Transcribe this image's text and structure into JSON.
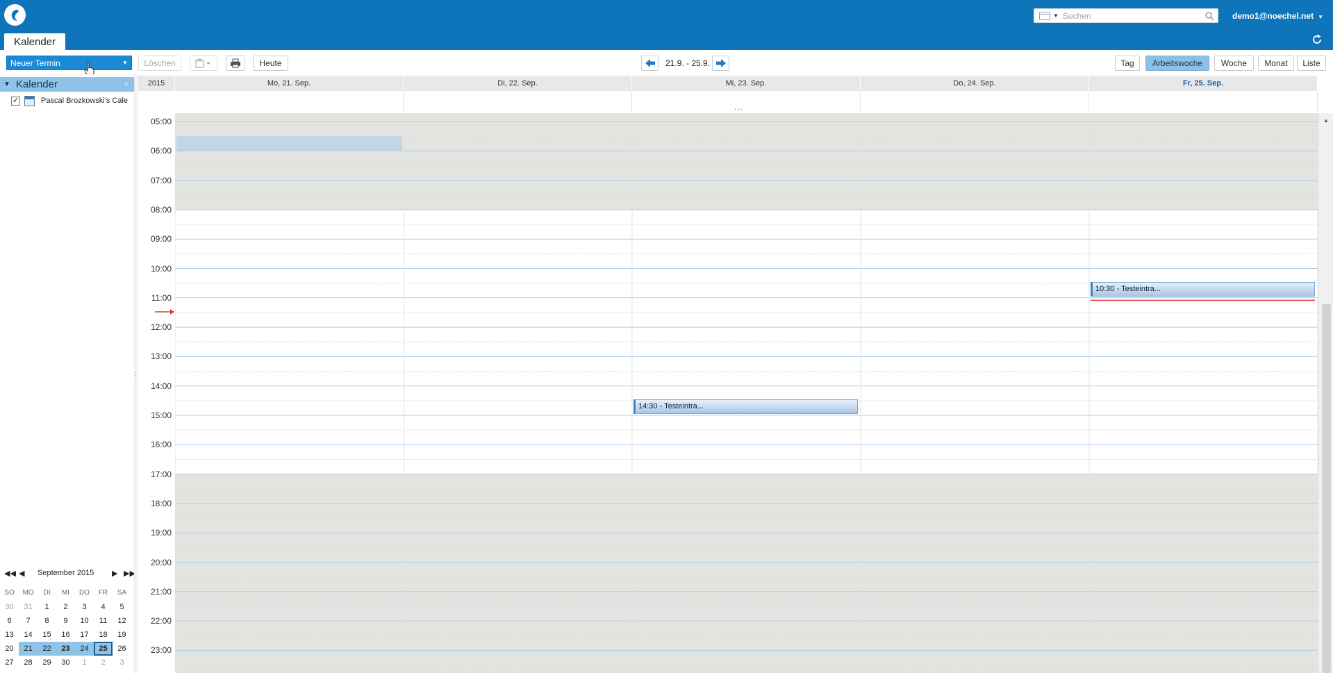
{
  "app": {
    "tab_label": "Kalender",
    "search_placeholder": "Suchen",
    "user": "demo1@noechel.net"
  },
  "toolbar": {
    "new_label": "Neuer Termin",
    "delete_label": "Löschen",
    "today_label": "Heute",
    "range_label": "21.9. - 25.9.",
    "views": [
      "Tag",
      "Arbeitswoche",
      "Woche",
      "Monat",
      "Liste"
    ],
    "active_view": "Arbeitswoche"
  },
  "sidebar": {
    "section_title": "Kalender",
    "calendar_name": "Pascal Brozkowski's Cale"
  },
  "mini_calendar": {
    "month_label": "September 2015",
    "weekdays": [
      "SO",
      "MO",
      "DI",
      "MI",
      "DO",
      "FR",
      "SA"
    ],
    "weeks": [
      [
        "30",
        "31",
        "1",
        "2",
        "3",
        "4",
        "5"
      ],
      [
        "6",
        "7",
        "8",
        "9",
        "10",
        "11",
        "12"
      ],
      [
        "13",
        "14",
        "15",
        "16",
        "17",
        "18",
        "19"
      ],
      [
        "20",
        "21",
        "22",
        "23",
        "24",
        "25",
        "26"
      ],
      [
        "27",
        "28",
        "29",
        "30",
        "1",
        "2",
        "3"
      ]
    ]
  },
  "calendar": {
    "year_label": "2015",
    "days": [
      "Mo, 21. Sep.",
      "Di, 22. Sep.",
      "Mi, 23. Sep.",
      "Do, 24. Sep.",
      "Fr, 25. Sep."
    ],
    "current_day": "Fr, 25. Sep.",
    "more_indicator": "...",
    "hours": [
      "05:00",
      "06:00",
      "07:00",
      "08:00",
      "09:00",
      "10:00",
      "11:00",
      "12:00",
      "13:00",
      "14:00",
      "15:00",
      "16:00",
      "17:00",
      "18:00",
      "19:00",
      "20:00",
      "21:00",
      "22:00",
      "23:00"
    ],
    "work_start": "08:00",
    "work_end": "17:00",
    "events": [
      {
        "day": "Mi, 23. Sep.",
        "start": "14:30",
        "label": "14:30 - Testeintra..."
      },
      {
        "day": "Fr, 25. Sep.",
        "start": "10:30",
        "label": "10:30 - Testeintra..."
      }
    ],
    "current_time": "11:05"
  },
  "colors": {
    "brand": "#0f75bb",
    "accent": "#8fc3e8",
    "offhours": "#e3e3e0",
    "now_line": "#e03a3a"
  }
}
